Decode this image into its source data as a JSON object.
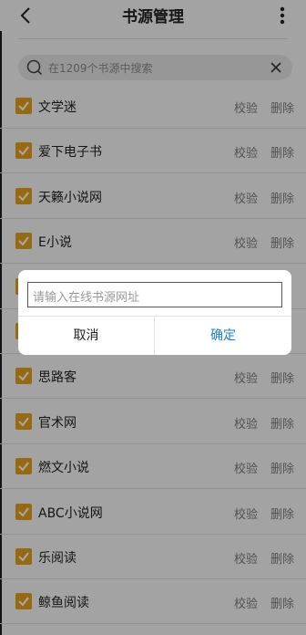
{
  "header": {
    "title": "书源管理",
    "back_icon": "back-arrow-icon",
    "more_icon": "more-vertical-icon"
  },
  "search": {
    "placeholder": "在1209个书源中搜索",
    "search_icon": "search-icon",
    "clear_icon": "close-icon"
  },
  "sources": [
    {
      "name": "文学迷",
      "checked": true,
      "verify": "校验",
      "delete": "删除"
    },
    {
      "name": "爱下电子书",
      "checked": true,
      "verify": "校验",
      "delete": "删除"
    },
    {
      "name": "天籁小说网",
      "checked": true,
      "verify": "校验",
      "delete": "删除"
    },
    {
      "name": "E小说",
      "checked": true,
      "verify": "校验",
      "delete": "删除"
    },
    {
      "name": "",
      "checked": true,
      "verify": "",
      "delete": ""
    },
    {
      "name": "",
      "checked": true,
      "verify": "",
      "delete": ""
    },
    {
      "name": "思路客",
      "checked": true,
      "verify": "校验",
      "delete": "删除"
    },
    {
      "name": "官术网",
      "checked": true,
      "verify": "校验",
      "delete": "删除"
    },
    {
      "name": "燃文小说",
      "checked": true,
      "verify": "校验",
      "delete": "删除"
    },
    {
      "name": "ABC小说网",
      "checked": true,
      "verify": "校验",
      "delete": "删除"
    },
    {
      "name": "乐阅读",
      "checked": true,
      "verify": "校验",
      "delete": "删除"
    },
    {
      "name": "鲸鱼阅读",
      "checked": true,
      "verify": "校验",
      "delete": "删除"
    }
  ],
  "dialog": {
    "input_placeholder": "请输入在线书源网址",
    "cancel": "取消",
    "confirm": "确定"
  },
  "colors": {
    "checkbox": "#e6a11a",
    "confirm": "#1a7fd4"
  }
}
